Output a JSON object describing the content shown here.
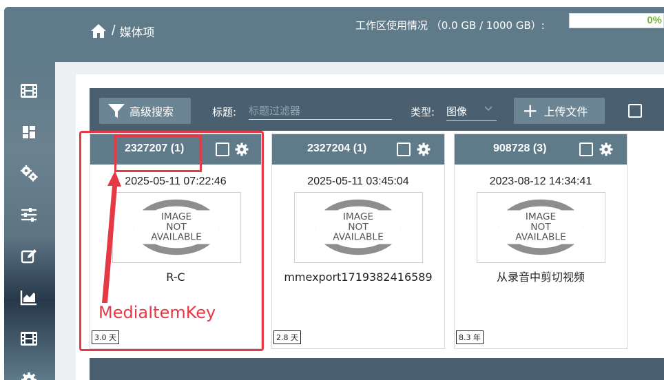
{
  "header": {
    "breadcrumb_sep": "/",
    "breadcrumb_current": "媒体项",
    "usage_label": "工作区使用情况 （0.0 GB / 1000 GB）:",
    "usage_percent": "0%",
    "usage_fraction": 0.0
  },
  "sidebar": {
    "items": [
      {
        "icon": "film-icon"
      },
      {
        "icon": "dashboard-icon"
      },
      {
        "icon": "gears-icon"
      },
      {
        "icon": "sliders-icon"
      },
      {
        "icon": "edit-icon"
      },
      {
        "icon": "chart-icon"
      },
      {
        "icon": "film-icon"
      },
      {
        "icon": "gear-icon"
      }
    ]
  },
  "toolbar": {
    "advanced_search_label": "高级搜索",
    "title_label": "标题:",
    "title_placeholder": "标题过滤器",
    "type_label": "类型:",
    "type_value": "图像",
    "upload_label": "上传文件"
  },
  "cards": [
    {
      "key": "2327207 (1)",
      "date": "2025-05-11 07:22:46",
      "title": "R-C",
      "age": "3.0 天",
      "thumb_text": [
        "IMAGE",
        "NOT",
        "AVAILABLE"
      ]
    },
    {
      "key": "2327204 (1)",
      "date": "2025-05-11 03:45:04",
      "title": "mmexport1719382416589",
      "age": "2.8 天",
      "thumb_text": [
        "IMAGE",
        "NOT",
        "AVAILABLE"
      ]
    },
    {
      "key": "908728 (3)",
      "date": "2023-08-12 14:34:41",
      "title": "从录音中剪切视频",
      "age": "8.3 年",
      "thumb_text": [
        "IMAGE",
        "NOT",
        "AVAILABLE"
      ]
    }
  ],
  "annotation": {
    "label": "MediaItemKey",
    "color": "#e53946"
  },
  "colors": {
    "header_bg": "#5f7a89",
    "toolbar_bg": "#4a6070",
    "button_bg": "#6c8594",
    "usage_text": "#7cb342"
  }
}
